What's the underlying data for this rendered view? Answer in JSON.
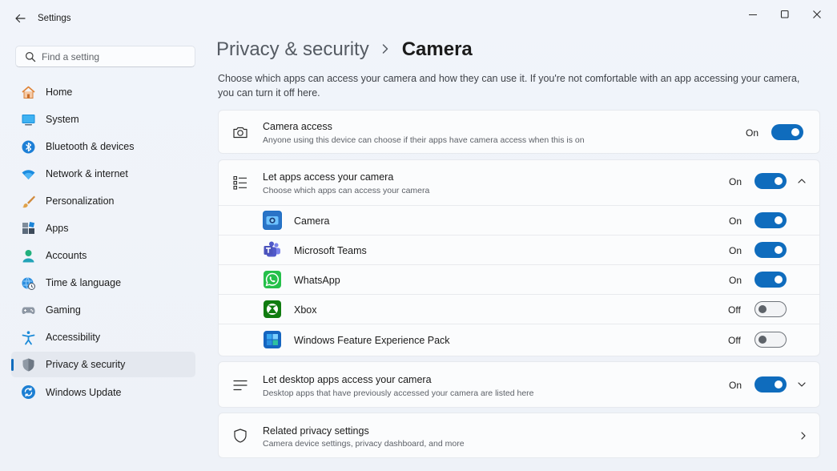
{
  "app": {
    "title": "Settings"
  },
  "search": {
    "placeholder": "Find a setting"
  },
  "sidebar": {
    "items": [
      {
        "label": "Home",
        "icon": "home-icon"
      },
      {
        "label": "System",
        "icon": "system-icon"
      },
      {
        "label": "Bluetooth & devices",
        "icon": "bluetooth-icon"
      },
      {
        "label": "Network & internet",
        "icon": "wifi-icon"
      },
      {
        "label": "Personalization",
        "icon": "brush-icon"
      },
      {
        "label": "Apps",
        "icon": "apps-icon"
      },
      {
        "label": "Accounts",
        "icon": "accounts-icon"
      },
      {
        "label": "Time & language",
        "icon": "globe-clock-icon"
      },
      {
        "label": "Gaming",
        "icon": "gamepad-icon"
      },
      {
        "label": "Accessibility",
        "icon": "accessibility-icon"
      },
      {
        "label": "Privacy & security",
        "icon": "shield-icon",
        "active": true
      },
      {
        "label": "Windows Update",
        "icon": "update-icon"
      }
    ]
  },
  "breadcrumb": {
    "parent": "Privacy & security",
    "separator": ">",
    "current": "Camera"
  },
  "page": {
    "description": "Choose which apps can access your camera and how they can use it. If you're not comfortable with an app accessing your camera, you can turn it off here."
  },
  "camera_access": {
    "title": "Camera access",
    "subtitle": "Anyone using this device can choose if their apps have camera access when this is on",
    "state": "On",
    "on": true
  },
  "let_apps": {
    "title": "Let apps access your camera",
    "subtitle": "Choose which apps can access your camera",
    "state": "On",
    "on": true,
    "expanded": true,
    "apps": [
      {
        "name": "Camera",
        "state": "On",
        "on": true,
        "icon": "camera-app-icon"
      },
      {
        "name": "Microsoft Teams",
        "state": "On",
        "on": true,
        "icon": "teams-icon"
      },
      {
        "name": "WhatsApp",
        "state": "On",
        "on": true,
        "icon": "whatsapp-icon"
      },
      {
        "name": "Xbox",
        "state": "Off",
        "on": false,
        "icon": "xbox-icon"
      },
      {
        "name": "Windows Feature Experience Pack",
        "state": "Off",
        "on": false,
        "icon": "feature-pack-icon"
      }
    ]
  },
  "desktop_apps": {
    "title": "Let desktop apps access your camera",
    "subtitle": "Desktop apps that have previously accessed your camera are listed here",
    "state": "On",
    "on": true
  },
  "related": {
    "title": "Related privacy settings",
    "subtitle": "Camera device settings, privacy dashboard, and more"
  },
  "colors": {
    "accent": "#0f6cbd",
    "background": "#eef2f8",
    "card": "#fbfcfd"
  }
}
